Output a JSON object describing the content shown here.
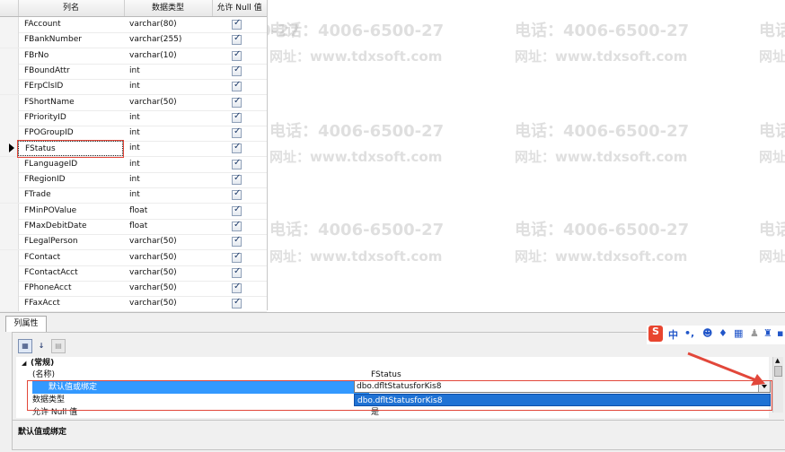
{
  "columns_grid": {
    "headers": [
      "列名",
      "数据类型",
      "允许 Null 值"
    ],
    "rows": [
      {
        "name": "FAccount",
        "type": "varchar(80)",
        "null": "✓"
      },
      {
        "name": "FBankNumber",
        "type": "varchar(255)",
        "null": "✓"
      },
      {
        "name": "FBrNo",
        "type": "varchar(10)",
        "null": "✓"
      },
      {
        "name": "FBoundAttr",
        "type": "int",
        "null": "✓"
      },
      {
        "name": "FErpClsID",
        "type": "int",
        "null": "✓"
      },
      {
        "name": "FShortName",
        "type": "varchar(50)",
        "null": "✓"
      },
      {
        "name": "FPriorityID",
        "type": "int",
        "null": "✓"
      },
      {
        "name": "FPOGroupID",
        "type": "int",
        "null": "✓"
      },
      {
        "name": "FStatus",
        "type": "int",
        "null": "✓"
      },
      {
        "name": "FLanguageID",
        "type": "int",
        "null": "✓"
      },
      {
        "name": "FRegionID",
        "type": "int",
        "null": "✓"
      },
      {
        "name": "FTrade",
        "type": "int",
        "null": "✓"
      },
      {
        "name": "FMinPOValue",
        "type": "float",
        "null": "✓"
      },
      {
        "name": "FMaxDebitDate",
        "type": "float",
        "null": "✓"
      },
      {
        "name": "FLegalPerson",
        "type": "varchar(50)",
        "null": "✓"
      },
      {
        "name": "FContact",
        "type": "varchar(50)",
        "null": "✓"
      },
      {
        "name": "FContactAcct",
        "type": "varchar(50)",
        "null": "✓"
      },
      {
        "name": "FPhoneAcct",
        "type": "varchar(50)",
        "null": "✓"
      },
      {
        "name": "FFaxAcct",
        "type": "varchar(50)",
        "null": "✓"
      }
    ]
  },
  "watermark": {
    "phone": "电话：4006-6500-27",
    "site": "网址：www.tdxsoft.com"
  },
  "properties": {
    "tab_label": "列属性",
    "group_label": "(常规)",
    "name_label": "(名称)",
    "name_value": "FStatus",
    "default_label": "默认值或绑定",
    "default_value": "dbo.dfltStatusforKis8",
    "dropdown_option": "dbo.dfltStatusforKis8",
    "type_label": "数据类型",
    "allow_null_label": "允许 Null 值",
    "allow_null_value": "是",
    "description_label": "默认值或绑定"
  },
  "ime": {
    "logo": "S",
    "mode": "中"
  },
  "colors": {
    "accent_red": "#e2473a",
    "selection_blue": "#1f72d4"
  }
}
